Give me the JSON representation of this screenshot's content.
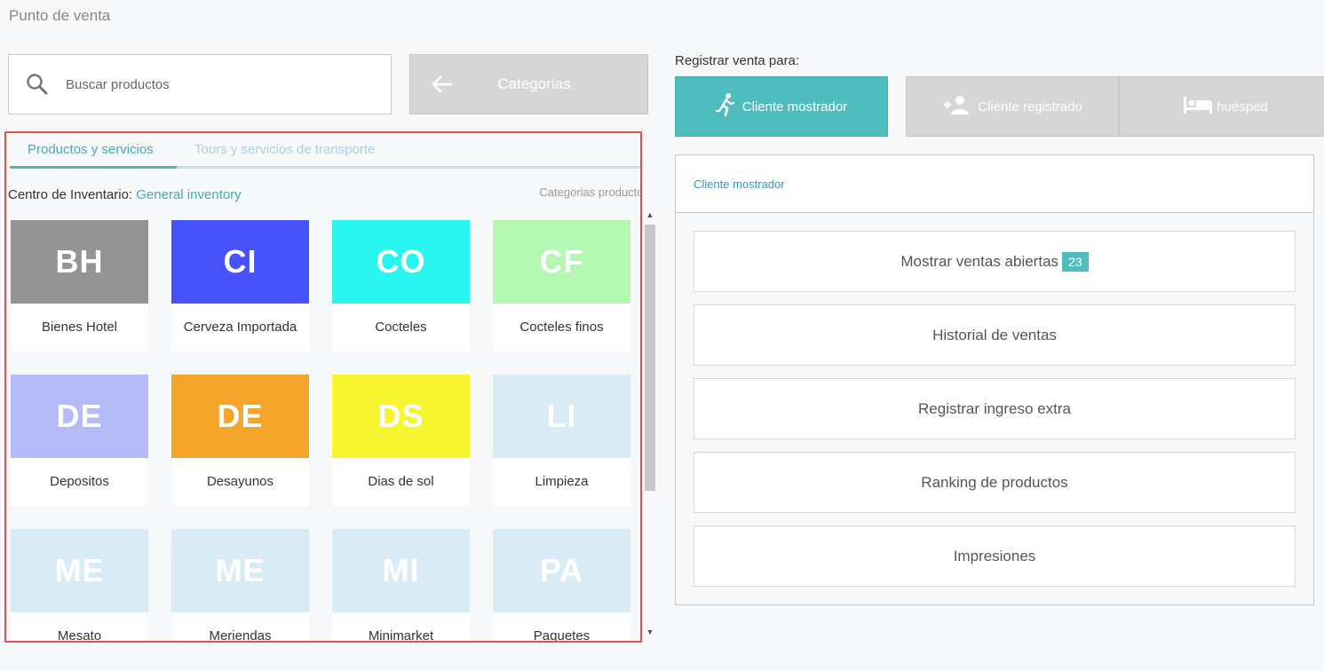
{
  "header": {
    "title": "Punto de venta"
  },
  "search": {
    "placeholder": "Buscar productos"
  },
  "categories_button": {
    "label": "Categorias"
  },
  "tabs": [
    {
      "label": "Productos y servicios",
      "active": true
    },
    {
      "label": "Tours y servicios de transporte",
      "active": false
    }
  ],
  "inventory": {
    "prefix": "Centro de Inventario: ",
    "name": "General inventory",
    "categories_link": "Categorias productos"
  },
  "products": [
    {
      "code": "BH",
      "label": "Bienes Hotel",
      "color": "#949494"
    },
    {
      "code": "CI",
      "label": "Cerveza Importada",
      "color": "#4653fa"
    },
    {
      "code": "CO",
      "label": "Cocteles",
      "color": "#29f6f0"
    },
    {
      "code": "CF",
      "label": "Cocteles finos",
      "color": "#b4f8b3"
    },
    {
      "code": "DE",
      "label": "Depositos",
      "color": "#b4bbf6"
    },
    {
      "code": "DE",
      "label": "Desayunos",
      "color": "#f6a52b"
    },
    {
      "code": "DS",
      "label": "Dias de sol",
      "color": "#f6f52f"
    },
    {
      "code": "LI",
      "label": "Limpieza",
      "color": "#d9ecf6"
    },
    {
      "code": "ME",
      "label": "Mesato",
      "color": "#d9ecf6"
    },
    {
      "code": "ME",
      "label": "Meriendas",
      "color": "#d9ecf6"
    },
    {
      "code": "MI",
      "label": "Minimarket",
      "color": "#d9ecf6"
    },
    {
      "code": "PA",
      "label": "Paquetes",
      "color": "#d9ecf6"
    }
  ],
  "register": {
    "label": "Registrar venta para:",
    "clients": [
      {
        "label": "Cliente mostrador",
        "icon": "running-person-icon",
        "active": true
      },
      {
        "label": "Cliente registrado",
        "icon": "add-user-icon",
        "active": false
      },
      {
        "label": "huésped",
        "icon": "bed-icon",
        "active": false
      }
    ]
  },
  "client_panel": {
    "title": "Cliente mostrador",
    "actions": [
      {
        "label": "Mostrar ventas abiertas",
        "badge": "23"
      },
      {
        "label": "Historial de ventas"
      },
      {
        "label": "Registrar ingreso extra"
      },
      {
        "label": "Ranking de productos"
      },
      {
        "label": "Impresiones"
      }
    ]
  },
  "colors": {
    "accent": "#4fbcbd",
    "link": "#4aa8b5",
    "highlight_border": "#e25050"
  }
}
